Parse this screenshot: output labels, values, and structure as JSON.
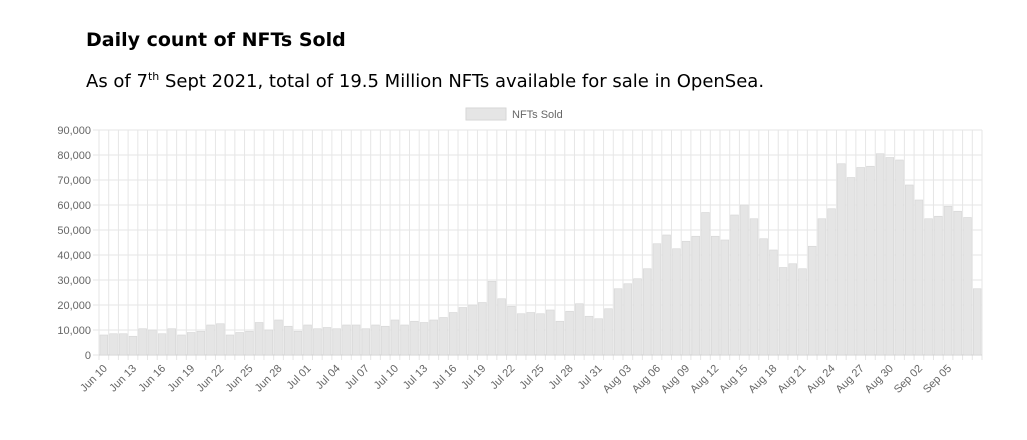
{
  "header": {
    "title": "Daily count of NFTs Sold",
    "subtitle_pre": "As of 7",
    "subtitle_sup": "th",
    "subtitle_post": " Sept 2021, total of 19.5 Million NFTs available for sale in OpenSea."
  },
  "colors": {
    "bar": "#e5e5e5",
    "bar_border": "#d6d6d6",
    "grid": "#e6e6e6",
    "text": "#666666"
  },
  "chart_data": {
    "type": "bar",
    "title": "",
    "xlabel": "",
    "ylabel": "",
    "legend": {
      "position": "top-center",
      "entries": [
        "NFTs Sold"
      ]
    },
    "grid": true,
    "ylim": [
      0,
      90000
    ],
    "yticks": [
      "0",
      "10,000",
      "20,000",
      "30,000",
      "40,000",
      "50,000",
      "60,000",
      "70,000",
      "80,000",
      "90,000"
    ],
    "xtick_labels": [
      "Jun 10",
      "Jun 13",
      "Jun 16",
      "Jun 19",
      "Jun 22",
      "Jun 25",
      "Jun 28",
      "Jul 01",
      "Jul 04",
      "Jul 07",
      "Jul 10",
      "Jul 13",
      "Jul 16",
      "Jul 19",
      "Jul 22",
      "Jul 25",
      "Jul 28",
      "Jul 31",
      "Aug 03",
      "Aug 06",
      "Aug 09",
      "Aug 12",
      "Aug 15",
      "Aug 18",
      "Aug 21",
      "Aug 24",
      "Aug 27",
      "Aug 30",
      "Sep 02",
      "Sep 05"
    ],
    "series": [
      {
        "name": "NFTs Sold",
        "values": [
          8000,
          8500,
          8500,
          7500,
          10500,
          10000,
          8500,
          10500,
          8000,
          9000,
          9500,
          12000,
          12500,
          8000,
          9000,
          9500,
          13000,
          10000,
          14000,
          11500,
          9500,
          12000,
          10500,
          11000,
          10500,
          12000,
          12000,
          10500,
          12000,
          11500,
          14000,
          12000,
          13500,
          13000,
          14000,
          15000,
          17000,
          19000,
          20000,
          21000,
          29500,
          22500,
          19500,
          16500,
          17000,
          16500,
          18000,
          13500,
          17500,
          20500,
          15500,
          14500,
          18500,
          26500,
          28500,
          30500,
          34500,
          44500,
          48000,
          42500,
          45500,
          47500,
          57000,
          47500,
          46000,
          56000,
          60000,
          54500,
          46500,
          42000,
          35000,
          36500,
          34500,
          43500,
          54500,
          58500,
          76500,
          71000,
          75000,
          75500,
          80500,
          79000,
          78000,
          68000,
          62000,
          54500,
          55500,
          59500,
          57500,
          55000,
          26500
        ]
      }
    ]
  }
}
